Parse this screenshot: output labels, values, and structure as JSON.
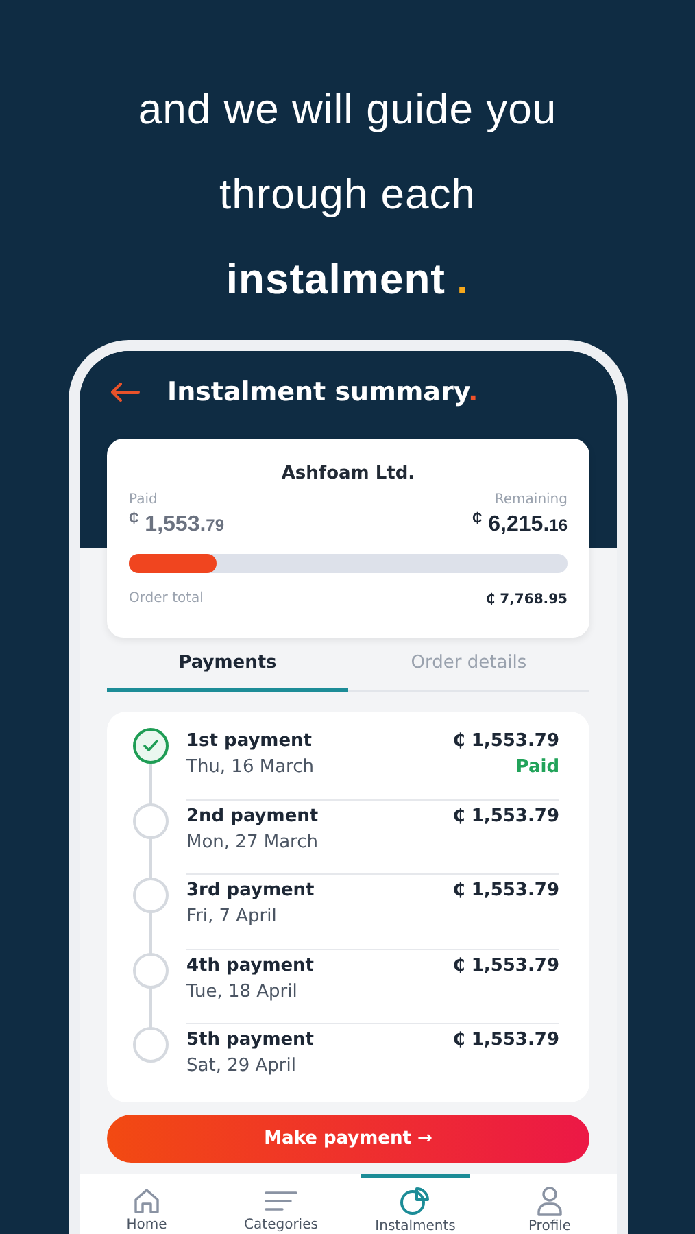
{
  "headline": {
    "lines": [
      {
        "text": "and we will guide you",
        "bold": false
      },
      {
        "text": "through each",
        "bold": false
      },
      {
        "text": "instalment",
        "bold": true
      }
    ],
    "accent": "."
  },
  "screen": {
    "title": "Instalment summary",
    "title_accent": ".",
    "summary": {
      "merchant": "Ashfoam Ltd.",
      "paid_label": "Paid",
      "paid": {
        "currency": "₵",
        "whole": "1,553.",
        "fraction": "79"
      },
      "remaining_label": "Remaining",
      "remaining": {
        "currency": "₵",
        "whole": "6,215.",
        "fraction": "16"
      },
      "level": 0.2,
      "total_label": "Order total",
      "total": "₵ 7,768.95"
    },
    "tabs": [
      {
        "label": "Payments",
        "selected": true
      },
      {
        "label": "Order details",
        "selected": false
      }
    ],
    "payments": [
      {
        "title": "1st payment",
        "date": "Thu, 16 March",
        "amount": "₵ 1,553.79",
        "paid": true,
        "status": "Paid"
      },
      {
        "title": "2nd payment",
        "date": "Mon, 27 March",
        "amount": "₵ 1,553.79",
        "paid": false
      },
      {
        "title": "3rd payment",
        "date": "Fri, 7 April",
        "amount": "₵ 1,553.79",
        "paid": false
      },
      {
        "title": "4th payment",
        "date": "Tue, 18 April",
        "amount": "₵ 1,553.79",
        "paid": false
      },
      {
        "title": "5th payment",
        "date": "Sat, 29 April",
        "amount": "₵ 1,553.79",
        "paid": false
      }
    ],
    "button": "Make payment →",
    "nav": [
      {
        "label": "Home",
        "selected": false
      },
      {
        "label": "Categories",
        "selected": false
      },
      {
        "label": "Instalments",
        "selected": true
      },
      {
        "label": "Profile",
        "selected": false
      }
    ]
  }
}
